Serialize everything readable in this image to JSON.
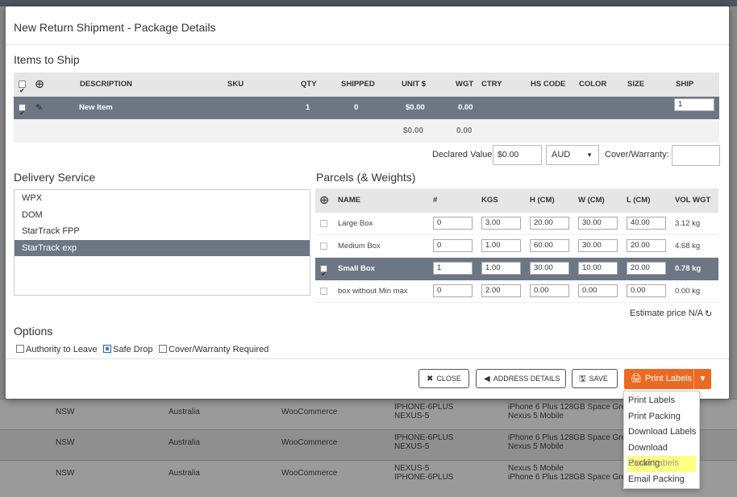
{
  "background": {
    "rows": [
      {
        "state": "NSW",
        "country": "Australia",
        "store": "WooCommerce",
        "sku": [
          "IPHONE-6PLUS",
          "NEXUS-5"
        ],
        "product": [
          "iPhone 6 Plus 128GB Space Grey",
          "Nexus 5 Mobile"
        ]
      },
      {
        "state": "NSW",
        "country": "Australia",
        "store": "WooCommerce",
        "sku": [
          "IPHONE-6PLUS",
          "NEXUS-5"
        ],
        "product": [
          "iPhone 6 Plus 128GB Space Grey",
          "Nexus 5 Mobile"
        ]
      },
      {
        "state": "NSW",
        "country": "Australia",
        "store": "WooCommerce",
        "sku": [
          "NEXUS-5",
          "IPHONE-6PLUS"
        ],
        "product": [
          "Nexus 5 Mobile",
          "iPhone 6 Plus 128GB Space Grey"
        ]
      }
    ]
  },
  "modal": {
    "title": "New Return Shipment - Package Details",
    "items_section": "Items to Ship",
    "items_headers": {
      "description": "DESCRIPTION",
      "sku": "SKU",
      "qty": "QTY",
      "shipped": "SHIPPED",
      "unit": "UNIT $",
      "wgt": "WGT",
      "ctry": "CTRY",
      "hs": "HS CODE",
      "color": "COLOR",
      "size": "SIZE",
      "ship": "SHIP"
    },
    "item": {
      "description": "New Item",
      "qty": "1",
      "shipped": "0",
      "unit": "$0.00",
      "wgt": "0.00",
      "ship": "1"
    },
    "totals": {
      "unit": "$0.00",
      "wgt": "0.00"
    },
    "declared_value_label": "Declared Value:",
    "declared_value": "$0.00",
    "currency": "AUD",
    "cover_label": "Cover/Warranty:",
    "cover_value": "",
    "delivery_section": "Delivery Service",
    "delivery_services": [
      "WPX",
      "DOM",
      "StarTrack FPP",
      "StarTrack exp"
    ],
    "parcels_section": "Parcels (& Weights)",
    "parcel_headers": {
      "name": "NAME",
      "count": "#",
      "kgs": "KGS",
      "h": "H (CM)",
      "w": "W (CM)",
      "l": "L (CM)",
      "vol": "VOL WGT"
    },
    "parcels": [
      {
        "name": "Large Box",
        "count": "0",
        "kgs": "3.00",
        "h": "20.00",
        "w": "30.00",
        "l": "40.00",
        "vol": "3.12 kg"
      },
      {
        "name": "Medium Box",
        "count": "0",
        "kgs": "1.00",
        "h": "60.00",
        "w": "30.00",
        "l": "20.00",
        "vol": "4.68 kg"
      },
      {
        "name": "Small Box",
        "count": "1",
        "kgs": "1.00",
        "h": "30.00",
        "w": "10.00",
        "l": "20.00",
        "vol": "0.78 kg"
      },
      {
        "name": "box without Min max",
        "count": "0",
        "kgs": "2.00",
        "h": "0.00",
        "w": "0.00",
        "l": "0.00",
        "vol": "0.00 kg"
      }
    ],
    "estimate": "Estimate price N/A",
    "options_section": "Options",
    "options": [
      {
        "label": "Authority to Leave",
        "checked": false
      },
      {
        "label": "Safe Drop",
        "checked": true
      },
      {
        "label": "Cover/Warranty Required",
        "checked": false
      }
    ],
    "buttons": {
      "close": "CLOSE",
      "address": "ADDRESS DETAILS",
      "save": "SAVE",
      "print": "Print Labels"
    }
  },
  "print_menu": [
    "Print Labels",
    "Print Packing",
    "Download Labels",
    "Download Packing",
    "Email Labels",
    "Email Packing"
  ],
  "colors": {
    "accent": "#ea6a23",
    "selected_row": "#6c7684",
    "highlight": "#ffff80"
  }
}
